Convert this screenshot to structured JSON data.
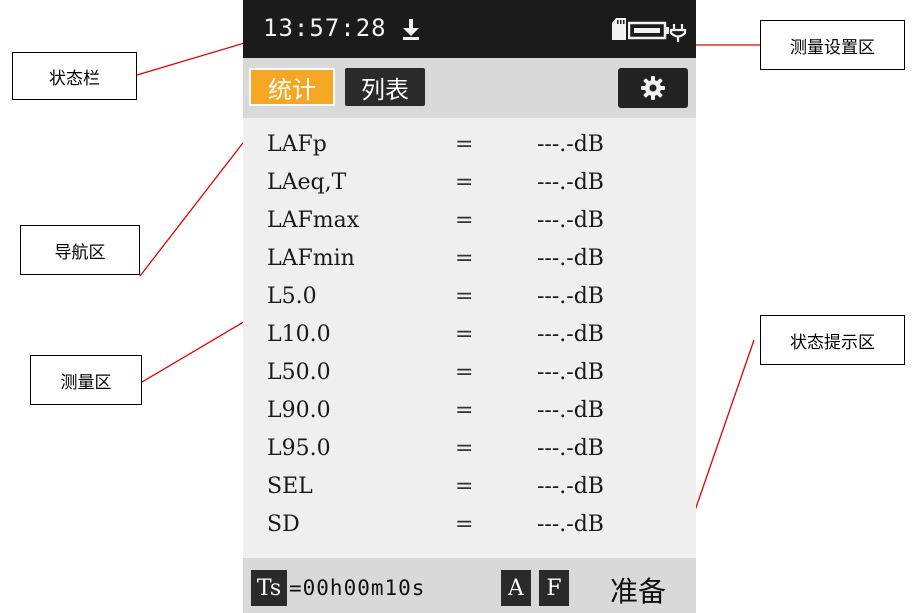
{
  "annotations": {
    "status_bar": "状态栏",
    "settings_area": "测量设置区",
    "nav_area": "导航区",
    "measure_area": "测量区",
    "status_hint_area": "状态提示区"
  },
  "status_bar": {
    "time": "13:57:28",
    "icons": [
      "download-icon",
      "sd-card-icon",
      "battery-charging-icon"
    ]
  },
  "nav": {
    "tabs": [
      {
        "label": "统计",
        "active": true
      },
      {
        "label": "列表",
        "active": false
      }
    ],
    "settings_icon": "gear-icon"
  },
  "measurements": [
    {
      "label": "LAFp",
      "eq": "=",
      "value": "---.-dB"
    },
    {
      "label": "LAeq,T",
      "eq": "=",
      "value": "---.-dB"
    },
    {
      "label": "LAFmax",
      "eq": "=",
      "value": "---.-dB"
    },
    {
      "label": "LAFmin",
      "eq": "=",
      "value": "---.-dB"
    },
    {
      "label": "L5.0",
      "eq": "=",
      "value": "---.-dB"
    },
    {
      "label": "L10.0",
      "eq": "=",
      "value": "---.-dB"
    },
    {
      "label": "L50.0",
      "eq": "=",
      "value": "---.-dB"
    },
    {
      "label": "L90.0",
      "eq": "=",
      "value": "---.-dB"
    },
    {
      "label": "L95.0",
      "eq": "=",
      "value": "---.-dB"
    },
    {
      "label": "SEL",
      "eq": "=",
      "value": "---.-dB"
    },
    {
      "label": "SD",
      "eq": "=",
      "value": "---.-dB"
    }
  ],
  "bottom_bar": {
    "ts_label": "Ts",
    "ts_value": "=00h00m10s",
    "freq_weighting": "A",
    "time_weighting": "F",
    "status": "准备"
  },
  "colors": {
    "active_tab": "#f5a623",
    "dark": "#2a2a2a",
    "screen_bg": "#efefef",
    "leader_line": "#e00000"
  }
}
